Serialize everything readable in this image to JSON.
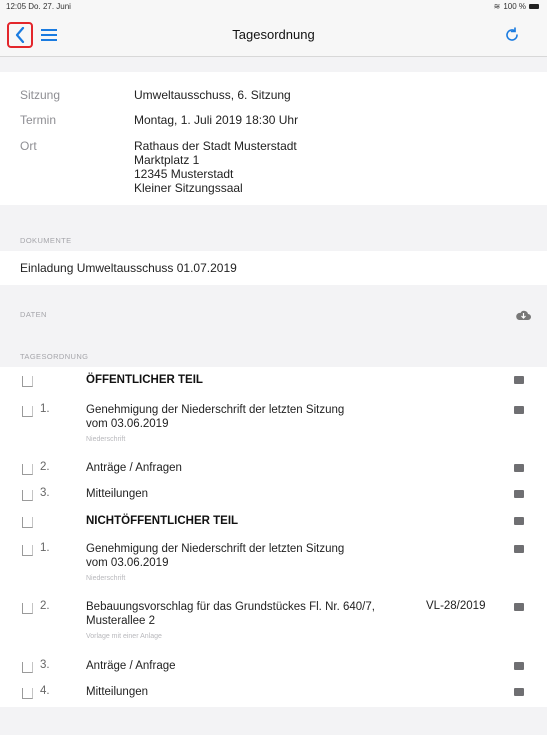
{
  "status": {
    "time": "12:05",
    "date": "Do. 27. Juni",
    "battery": "100 %"
  },
  "nav": {
    "title": "Tagesordnung"
  },
  "meeting": {
    "rows": [
      {
        "label": "Sitzung",
        "value": "Umweltausschuss, 6. Sitzung"
      },
      {
        "label": "Termin",
        "value": "Montag, 1. Juli 2019 18:30 Uhr"
      },
      {
        "label": "Ort",
        "value_lines": [
          "Rathaus der Stadt Musterstadt",
          "Marktplatz 1",
          "12345 Musterstadt",
          "Kleiner Sitzungssaal"
        ]
      }
    ]
  },
  "documents": {
    "header": "DOKUMENTE",
    "items": [
      "Einladung Umweltausschuss 01.07.2019"
    ]
  },
  "files": {
    "header": "DATEN"
  },
  "agenda": {
    "header": "TAGESORDNUNG",
    "items": [
      {
        "num": "",
        "title": "ÖFFENTLICHER TEIL",
        "bold": true
      },
      {
        "num": "1.",
        "title_lines": [
          "Genehmigung der Niederschrift der letzten Sitzung",
          "vom 03.06.2019"
        ],
        "sub": "Niederschrift"
      },
      {
        "num": "2.",
        "title": "Anträge / Anfragen"
      },
      {
        "num": "3.",
        "title": "Mitteilungen"
      },
      {
        "num": "",
        "title": "NICHTÖFFENTLICHER TEIL",
        "bold": true
      },
      {
        "num": "1.",
        "title_lines": [
          "Genehmigung der Niederschrift der letzten Sitzung",
          "vom 03.06.2019"
        ],
        "sub": "Niederschrift"
      },
      {
        "num": "2.",
        "title_lines": [
          "Bebauungsvorschlag für das Grundstückes Fl. Nr. 640/7,",
          "Musterallee 2"
        ],
        "sub": "Vorlage mit einer Anlage",
        "ref": "VL-28/2019"
      },
      {
        "num": "3.",
        "title": "Anträge / Anfrage"
      },
      {
        "num": "4.",
        "title": "Mitteilungen"
      }
    ]
  }
}
